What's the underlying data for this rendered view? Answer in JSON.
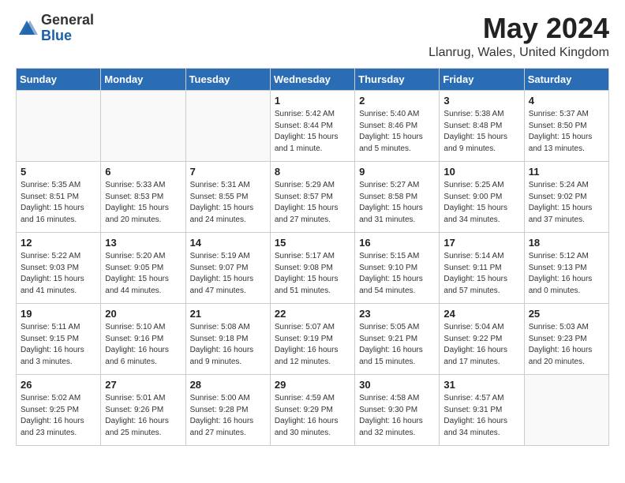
{
  "header": {
    "logo_general": "General",
    "logo_blue": "Blue",
    "title": "May 2024",
    "subtitle": "Llanrug, Wales, United Kingdom"
  },
  "days_of_week": [
    "Sunday",
    "Monday",
    "Tuesday",
    "Wednesday",
    "Thursday",
    "Friday",
    "Saturday"
  ],
  "weeks": [
    [
      {
        "num": "",
        "info": ""
      },
      {
        "num": "",
        "info": ""
      },
      {
        "num": "",
        "info": ""
      },
      {
        "num": "1",
        "info": "Sunrise: 5:42 AM\nSunset: 8:44 PM\nDaylight: 15 hours\nand 1 minute."
      },
      {
        "num": "2",
        "info": "Sunrise: 5:40 AM\nSunset: 8:46 PM\nDaylight: 15 hours\nand 5 minutes."
      },
      {
        "num": "3",
        "info": "Sunrise: 5:38 AM\nSunset: 8:48 PM\nDaylight: 15 hours\nand 9 minutes."
      },
      {
        "num": "4",
        "info": "Sunrise: 5:37 AM\nSunset: 8:50 PM\nDaylight: 15 hours\nand 13 minutes."
      }
    ],
    [
      {
        "num": "5",
        "info": "Sunrise: 5:35 AM\nSunset: 8:51 PM\nDaylight: 15 hours\nand 16 minutes."
      },
      {
        "num": "6",
        "info": "Sunrise: 5:33 AM\nSunset: 8:53 PM\nDaylight: 15 hours\nand 20 minutes."
      },
      {
        "num": "7",
        "info": "Sunrise: 5:31 AM\nSunset: 8:55 PM\nDaylight: 15 hours\nand 24 minutes."
      },
      {
        "num": "8",
        "info": "Sunrise: 5:29 AM\nSunset: 8:57 PM\nDaylight: 15 hours\nand 27 minutes."
      },
      {
        "num": "9",
        "info": "Sunrise: 5:27 AM\nSunset: 8:58 PM\nDaylight: 15 hours\nand 31 minutes."
      },
      {
        "num": "10",
        "info": "Sunrise: 5:25 AM\nSunset: 9:00 PM\nDaylight: 15 hours\nand 34 minutes."
      },
      {
        "num": "11",
        "info": "Sunrise: 5:24 AM\nSunset: 9:02 PM\nDaylight: 15 hours\nand 37 minutes."
      }
    ],
    [
      {
        "num": "12",
        "info": "Sunrise: 5:22 AM\nSunset: 9:03 PM\nDaylight: 15 hours\nand 41 minutes."
      },
      {
        "num": "13",
        "info": "Sunrise: 5:20 AM\nSunset: 9:05 PM\nDaylight: 15 hours\nand 44 minutes."
      },
      {
        "num": "14",
        "info": "Sunrise: 5:19 AM\nSunset: 9:07 PM\nDaylight: 15 hours\nand 47 minutes."
      },
      {
        "num": "15",
        "info": "Sunrise: 5:17 AM\nSunset: 9:08 PM\nDaylight: 15 hours\nand 51 minutes."
      },
      {
        "num": "16",
        "info": "Sunrise: 5:15 AM\nSunset: 9:10 PM\nDaylight: 15 hours\nand 54 minutes."
      },
      {
        "num": "17",
        "info": "Sunrise: 5:14 AM\nSunset: 9:11 PM\nDaylight: 15 hours\nand 57 minutes."
      },
      {
        "num": "18",
        "info": "Sunrise: 5:12 AM\nSunset: 9:13 PM\nDaylight: 16 hours\nand 0 minutes."
      }
    ],
    [
      {
        "num": "19",
        "info": "Sunrise: 5:11 AM\nSunset: 9:15 PM\nDaylight: 16 hours\nand 3 minutes."
      },
      {
        "num": "20",
        "info": "Sunrise: 5:10 AM\nSunset: 9:16 PM\nDaylight: 16 hours\nand 6 minutes."
      },
      {
        "num": "21",
        "info": "Sunrise: 5:08 AM\nSunset: 9:18 PM\nDaylight: 16 hours\nand 9 minutes."
      },
      {
        "num": "22",
        "info": "Sunrise: 5:07 AM\nSunset: 9:19 PM\nDaylight: 16 hours\nand 12 minutes."
      },
      {
        "num": "23",
        "info": "Sunrise: 5:05 AM\nSunset: 9:21 PM\nDaylight: 16 hours\nand 15 minutes."
      },
      {
        "num": "24",
        "info": "Sunrise: 5:04 AM\nSunset: 9:22 PM\nDaylight: 16 hours\nand 17 minutes."
      },
      {
        "num": "25",
        "info": "Sunrise: 5:03 AM\nSunset: 9:23 PM\nDaylight: 16 hours\nand 20 minutes."
      }
    ],
    [
      {
        "num": "26",
        "info": "Sunrise: 5:02 AM\nSunset: 9:25 PM\nDaylight: 16 hours\nand 23 minutes."
      },
      {
        "num": "27",
        "info": "Sunrise: 5:01 AM\nSunset: 9:26 PM\nDaylight: 16 hours\nand 25 minutes."
      },
      {
        "num": "28",
        "info": "Sunrise: 5:00 AM\nSunset: 9:28 PM\nDaylight: 16 hours\nand 27 minutes."
      },
      {
        "num": "29",
        "info": "Sunrise: 4:59 AM\nSunset: 9:29 PM\nDaylight: 16 hours\nand 30 minutes."
      },
      {
        "num": "30",
        "info": "Sunrise: 4:58 AM\nSunset: 9:30 PM\nDaylight: 16 hours\nand 32 minutes."
      },
      {
        "num": "31",
        "info": "Sunrise: 4:57 AM\nSunset: 9:31 PM\nDaylight: 16 hours\nand 34 minutes."
      },
      {
        "num": "",
        "info": ""
      }
    ]
  ]
}
